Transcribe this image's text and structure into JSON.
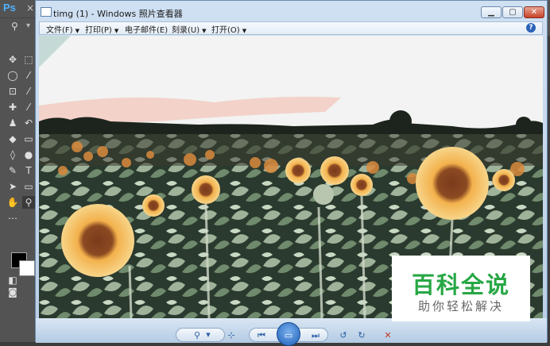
{
  "photoshop": {
    "logo": "Ps",
    "tab_close": "×"
  },
  "viewer": {
    "title": "timg (1) - Windows 照片查看器",
    "menu": [
      {
        "label": "文件(F)"
      },
      {
        "label": "打印(P)"
      },
      {
        "label": "电子邮件(E)"
      },
      {
        "label": "刻录(U)"
      },
      {
        "label": "打开(O)"
      }
    ],
    "help_label": "?",
    "toolbar_icons": [
      "zoom-icon",
      "actual-size-icon",
      "previous-icon",
      "slideshow-icon",
      "next-icon",
      "rotate-left-icon",
      "rotate-right-icon",
      "delete-icon"
    ]
  },
  "watermark": {
    "main": "百科全说",
    "sub": "助你轻松解决"
  },
  "colors": {
    "watermark_green": "#28a745",
    "ps_chrome": "#535353",
    "viewer_frame": "#b9cfe6"
  }
}
